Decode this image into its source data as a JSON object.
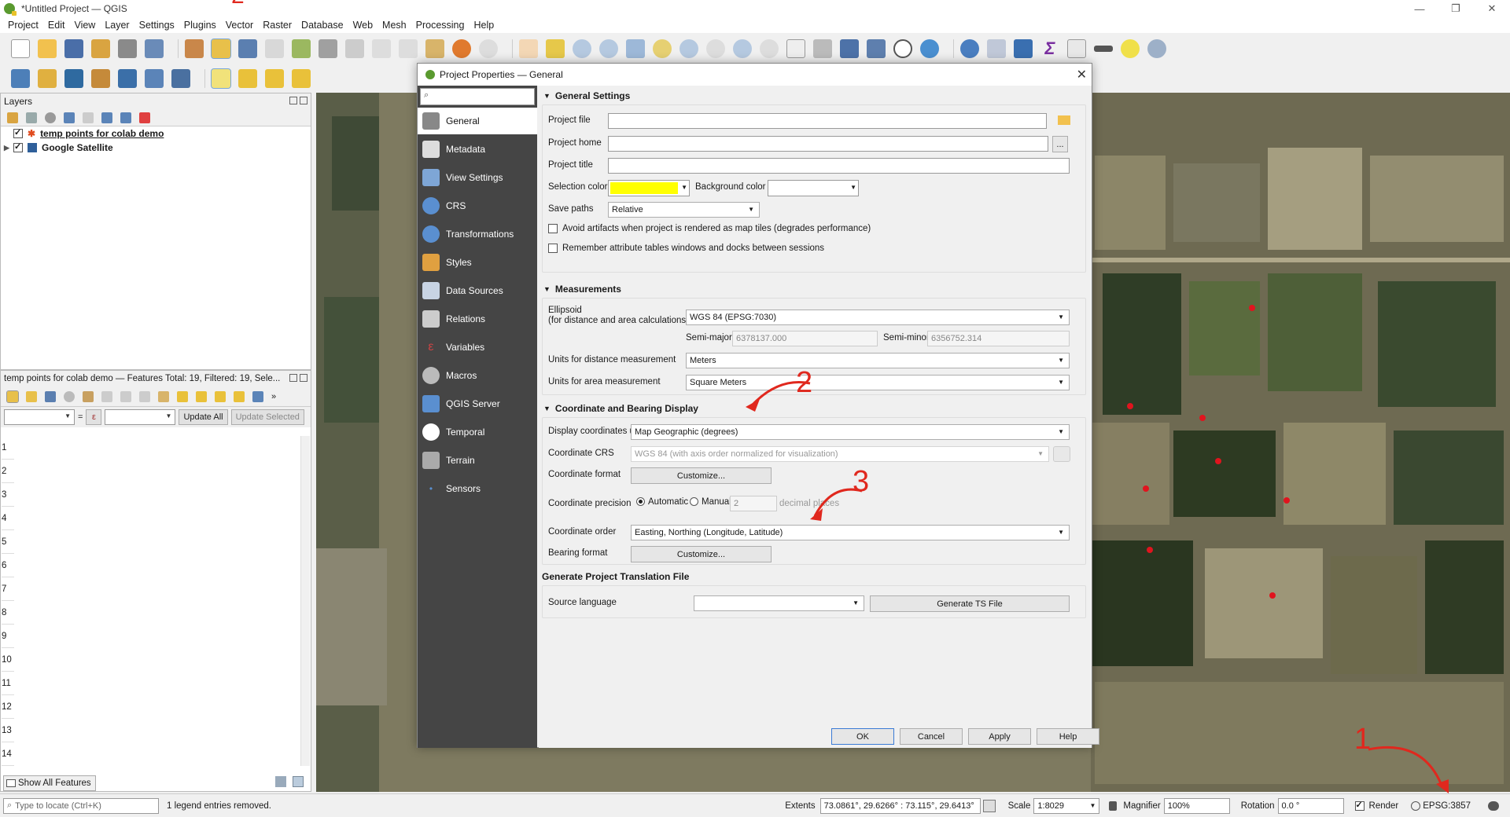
{
  "window": {
    "title": "*Untitled Project — QGIS"
  },
  "menu": [
    "Project",
    "Edit",
    "View",
    "Layer",
    "Settings",
    "Plugins",
    "Vector",
    "Raster",
    "Database",
    "Web",
    "Mesh",
    "Processing",
    "Help"
  ],
  "layers_panel": {
    "title": "Layers",
    "items": [
      {
        "label": "temp points for colab demo"
      },
      {
        "label": "Google Satellite"
      }
    ]
  },
  "attribute_table": {
    "title": "temp points for colab demo — Features Total: 19, Filtered: 19, Sele...",
    "update_all": "Update All",
    "update_selected": "Update Selected",
    "epsilon": "ε",
    "equals": "=",
    "rows": [
      "1",
      "2",
      "3",
      "4",
      "5",
      "6",
      "7",
      "8",
      "9",
      "10",
      "11",
      "12",
      "13",
      "14"
    ],
    "show_all": "Show All Features"
  },
  "dialog": {
    "title": "Project Properties — General",
    "nav": [
      "General",
      "Metadata",
      "View Settings",
      "CRS",
      "Transformations",
      "Styles",
      "Data Sources",
      "Relations",
      "Variables",
      "Macros",
      "QGIS Server",
      "Temporal",
      "Terrain",
      "Sensors"
    ],
    "general": {
      "header": "General Settings",
      "project_file": "Project file",
      "project_home": "Project home",
      "project_title": "Project title",
      "selection_color": "Selection color",
      "selection_color_value": "#ffff00",
      "background_color": "Background color",
      "save_paths": "Save paths",
      "save_paths_value": "Relative",
      "avoid_artifacts": "Avoid artifacts when project is rendered as map tiles (degrades performance)",
      "remember_tables": "Remember attribute tables windows and docks between sessions",
      "browse": "..."
    },
    "measurements": {
      "header": "Measurements",
      "ellipsoid": "Ellipsoid",
      "ellipsoid_sub": "(for distance and area calculations)",
      "ellipsoid_value": "WGS 84 (EPSG:7030)",
      "semi_major": "Semi-major",
      "semi_major_value": "6378137.000",
      "semi_minor": "Semi-minor",
      "semi_minor_value": "6356752.314",
      "dist_units": "Units for distance measurement",
      "dist_units_value": "Meters",
      "area_units": "Units for area measurement",
      "area_units_value": "Square Meters"
    },
    "coords": {
      "header": "Coordinate and Bearing Display",
      "display_using": "Display coordinates using",
      "display_using_value": "Map Geographic (degrees)",
      "crs": "Coordinate CRS",
      "crs_value": "WGS 84 (with axis order normalized for visualization)",
      "format": "Coordinate format",
      "customize": "Customize...",
      "precision": "Coordinate precision",
      "automatic": "Automatic",
      "manual": "Manual",
      "precision_value": "2",
      "decimal_places": "decimal places",
      "order": "Coordinate order",
      "order_value": "Easting, Northing (Longitude, Latitude)",
      "bearing": "Bearing format"
    },
    "translation": {
      "header": "Generate Project Translation File",
      "source_language": "Source language",
      "generate": "Generate TS File"
    },
    "buttons": {
      "ok": "OK",
      "cancel": "Cancel",
      "apply": "Apply",
      "help": "Help"
    }
  },
  "statusbar": {
    "locate_placeholder": "Type to locate (Ctrl+K)",
    "message": "1 legend entries removed.",
    "extents_label": "Extents",
    "extents_value": "73.0861°, 29.6266° : 73.115°, 29.6413°",
    "scale_label": "Scale",
    "scale_value": "1:8029",
    "magnifier_label": "Magnifier",
    "magnifier_value": "100%",
    "rotation_label": "Rotation",
    "rotation_value": "0.0 °",
    "render_label": "Render",
    "crs": "EPSG:3857"
  },
  "annotations": [
    "1",
    "2",
    "3",
    "2"
  ],
  "colors": {
    "accent_red": "#e0281e",
    "selection_yellow": "#ffff00"
  }
}
